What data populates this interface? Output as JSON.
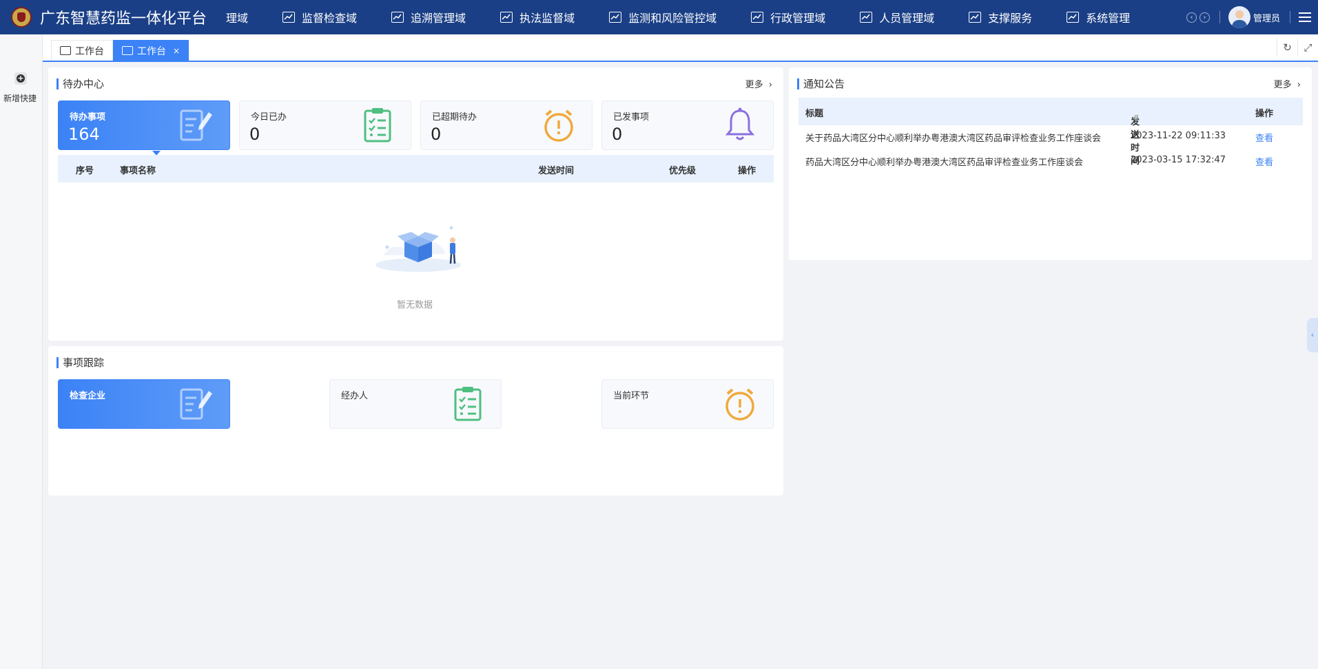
{
  "header": {
    "brand": "广东智慧药监一体化平台",
    "nav": [
      {
        "label": "理域",
        "icon": ""
      },
      {
        "label": "监督检查域",
        "icon": "chart-icon"
      },
      {
        "label": "追溯管理域",
        "icon": "chart-icon"
      },
      {
        "label": "执法监督域",
        "icon": "chart-icon"
      },
      {
        "label": "监测和风险管控域",
        "icon": "chart-icon"
      },
      {
        "label": "行政管理域",
        "icon": "chart-icon"
      },
      {
        "label": "人员管理域",
        "icon": "chart-icon"
      },
      {
        "label": "支撑服务",
        "icon": "chart-icon"
      },
      {
        "label": "系统管理",
        "icon": "chart-icon"
      }
    ],
    "user_name": "管理员"
  },
  "rail": {
    "add_label": "新增快捷"
  },
  "tabs": [
    {
      "label": "工作台",
      "active": false
    },
    {
      "label": "工作台",
      "active": true,
      "close": "×"
    }
  ],
  "todo": {
    "title": "待办中心",
    "more": "更多",
    "cards": [
      {
        "label": "待办事项",
        "value": "164",
        "icon": "edit-document-icon"
      },
      {
        "label": "今日已办",
        "value": "0",
        "icon": "clipboard-check-icon"
      },
      {
        "label": "已超期待办",
        "value": "0",
        "icon": "alarm-clock-icon"
      },
      {
        "label": "已发事项",
        "value": "0",
        "icon": "bell-icon"
      }
    ],
    "columns": [
      "序号",
      "事项名称",
      "发送时间",
      "优先级",
      "操作"
    ],
    "empty_text": "暂无数据"
  },
  "tracking": {
    "title": "事项跟踪",
    "cards": [
      {
        "label": "检查企业",
        "icon": "edit-document-icon"
      },
      {
        "label": "经办人",
        "icon": "clipboard-check-icon"
      },
      {
        "label": "当前环节",
        "icon": "alarm-clock-icon"
      }
    ]
  },
  "notice": {
    "title": "通知公告",
    "more": "更多",
    "columns": [
      "标题",
      "发送时间",
      "操作"
    ],
    "rows": [
      {
        "title": "关于药品大湾区分中心顺利举办粤港澳大湾区药品审评检查业务工作座谈会",
        "time": "2023-11-22 09:11:33",
        "action": "查看"
      },
      {
        "title": "药品大湾区分中心顺利举办粤港澳大湾区药品审评检查业务工作座谈会",
        "time": "2023-03-15 17:32:47",
        "action": "查看"
      }
    ]
  },
  "colors": {
    "primary": "#3b82f6",
    "header_bg": "#1a3f86",
    "green": "#4fbf7f",
    "orange": "#f0a93b",
    "purple": "#8b6fe0"
  }
}
